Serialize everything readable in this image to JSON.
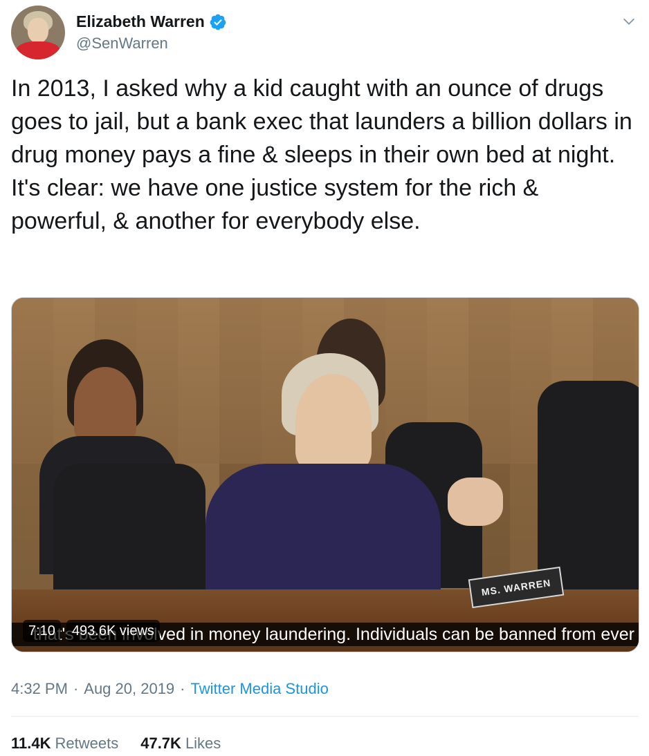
{
  "author": {
    "display_name": "Elizabeth Warren",
    "handle": "@SenWarren",
    "verified_icon": "verified-badge-icon",
    "accent_color": "#1da1f2"
  },
  "tweet": {
    "text": "In 2013, I asked why a kid caught with an ounce of drugs goes to jail, but a bank exec that launders a billion dollars in drug money pays a fine & sleeps in their own bed at night. It's clear: we have one justice system for the rich & powerful, & another for everybody else."
  },
  "media": {
    "duration": "7:10",
    "views": "493.6K views",
    "subtitle": "that's been involved in money laundering. Individuals can be banned from ever",
    "nameplate": "MS. WARREN"
  },
  "meta": {
    "time": "4:32 PM",
    "separator": "·",
    "date": "Aug 20, 2019",
    "source": "Twitter Media Studio"
  },
  "stats": {
    "retweets_count": "11.4K",
    "retweets_label": "Retweets",
    "likes_count": "47.7K",
    "likes_label": "Likes"
  }
}
